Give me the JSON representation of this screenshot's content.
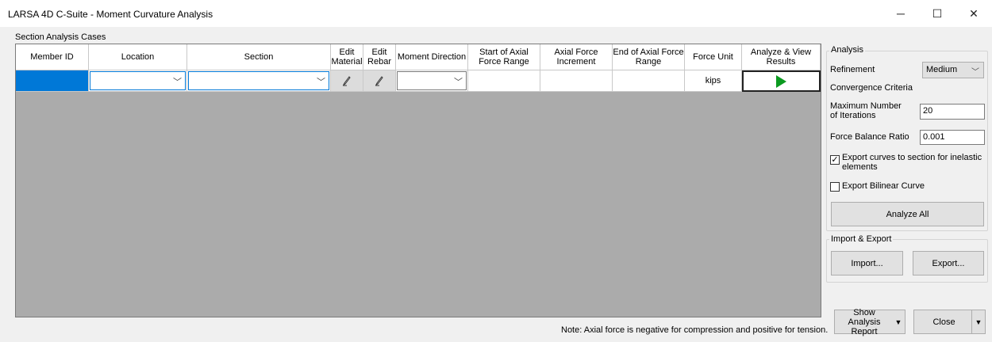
{
  "window": {
    "title": "LARSA 4D C-Suite - Moment Curvature Analysis",
    "minimize": "─",
    "maximize": "☐",
    "close": "✕"
  },
  "cases": {
    "label": "Section Analysis Cases",
    "headers": {
      "member_id": "Member ID",
      "location": "Location",
      "section": "Section",
      "edit_material": "Edit Material",
      "edit_rebar": "Edit Rebar",
      "moment_direction": "Moment Direction",
      "start_axial": "Start of Axial Force Range",
      "axial_increment": "Axial Force Increment",
      "end_axial": "End of Axial Force Range",
      "force_unit": "Force Unit",
      "analyze_view": "Analyze & View Results"
    },
    "row": {
      "member_id": "",
      "location": "",
      "section": "",
      "moment_direction": "",
      "start_axial": "",
      "axial_increment": "",
      "end_axial": "",
      "force_unit": "kips"
    },
    "note": "Note: Axial force is negative for compression and positive for tension."
  },
  "analysis": {
    "group_title": "Analysis",
    "refinement_label": "Refinement",
    "refinement_value": "Medium",
    "convergence_label": "Convergence Criteria",
    "max_iter_label": "Maximum Number of Iterations",
    "max_iter_value": "20",
    "force_balance_label": "Force Balance Ratio",
    "force_balance_value": "0.001",
    "export_curves_label": "Export curves to section for inelastic elements",
    "export_curves_checked": true,
    "export_bilinear_label": "Export Bilinear Curve",
    "export_bilinear_checked": false,
    "analyze_all": "Analyze All"
  },
  "import_export": {
    "group_title": "Import & Export",
    "import": "Import...",
    "export": "Export..."
  },
  "footer": {
    "show_report": "Show Analysis Report",
    "close": "Close"
  },
  "icons": {
    "dropdown": "chevron-down-icon",
    "edit": "pencil-icon",
    "run": "play-icon"
  },
  "colors": {
    "selection": "#0078d7",
    "play": "#0b9a20",
    "grid_background": "#ababab"
  }
}
